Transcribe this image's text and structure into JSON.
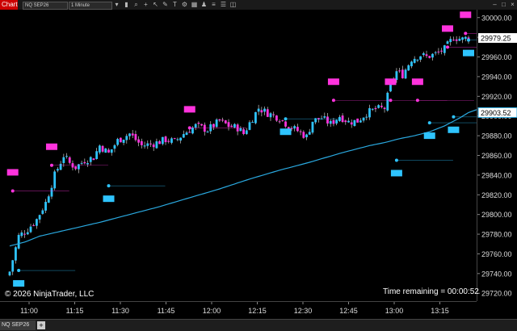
{
  "window": {
    "title": "Chart",
    "instrument": "NQ SEP26",
    "interval": "1 Minute",
    "bottom_tab": "NQ SEP26",
    "add_tab": "+"
  },
  "toolbar_icons": [
    "dropdown-icon",
    "bars-icon",
    "zoom-icon",
    "crosshair-icon",
    "pointer-icon",
    "draw-icon",
    "text-icon",
    "settings-icon",
    "grid-icon",
    "strategy-icon",
    "list-icon",
    "properties-icon",
    "chart-icon"
  ],
  "copyright": "© 2026 NinjaTrader, LLC",
  "time_remaining": "Time remaining = 00:00:52",
  "colors": {
    "up_candle": "#2ec4ff",
    "down_candle": "#ff33dd",
    "moving_average": "#2aa9e0",
    "high_marker": "#ff33dd",
    "low_marker": "#2ec4ff",
    "last_price_box": "#ffffff",
    "ma_price_box": "#ffffff"
  },
  "chart_data": {
    "type": "candlestick",
    "x_ticks": [
      "11:00",
      "11:15",
      "11:30",
      "11:45",
      "12:00",
      "12:15",
      "12:30",
      "12:45",
      "13:00",
      "13:15"
    ],
    "y_ticks": [
      "30000.00",
      "29980.00",
      "29960.00",
      "29940.00",
      "29920.00",
      "29900.00",
      "29880.00",
      "29860.00",
      "29840.00",
      "29820.00",
      "29800.00",
      "29780.00",
      "29760.00",
      "29740.00",
      "29720.00"
    ],
    "ylim": [
      29712,
      30008
    ],
    "last_price": "29979.25",
    "ma_price": "29903.52",
    "grid": false,
    "candle_count": 154,
    "close_path": [
      [
        0,
        29742
      ],
      [
        3,
        29778
      ],
      [
        6,
        29785
      ],
      [
        9,
        29795
      ],
      [
        12,
        29812
      ],
      [
        15,
        29840
      ],
      [
        18,
        29860
      ],
      [
        20,
        29852
      ],
      [
        22,
        29848
      ],
      [
        25,
        29855
      ],
      [
        28,
        29858
      ],
      [
        30,
        29870
      ],
      [
        33,
        29862
      ],
      [
        36,
        29875
      ],
      [
        40,
        29882
      ],
      [
        44,
        29870
      ],
      [
        48,
        29872
      ],
      [
        52,
        29876
      ],
      [
        55,
        29874
      ],
      [
        58,
        29882
      ],
      [
        62,
        29890
      ],
      [
        66,
        29886
      ],
      [
        70,
        29895
      ],
      [
        73,
        29890
      ],
      [
        76,
        29888
      ],
      [
        78,
        29882
      ],
      [
        80,
        29893
      ],
      [
        83,
        29908
      ],
      [
        86,
        29903
      ],
      [
        90,
        29898
      ],
      [
        93,
        29890
      ],
      [
        96,
        29885
      ],
      [
        99,
        29879
      ],
      [
        101,
        29895
      ],
      [
        104,
        29898
      ],
      [
        107,
        29892
      ],
      [
        110,
        29900
      ],
      [
        113,
        29894
      ],
      [
        116,
        29895
      ],
      [
        119,
        29903
      ],
      [
        122,
        29907
      ],
      [
        125,
        29908
      ],
      [
        127,
        29932
      ],
      [
        129,
        29945
      ],
      [
        131,
        29942
      ],
      [
        134,
        29958
      ],
      [
        137,
        29962
      ],
      [
        139,
        29960
      ],
      [
        142,
        29963
      ],
      [
        145,
        29968
      ],
      [
        148,
        29980
      ],
      [
        151,
        29978
      ],
      [
        153,
        29980
      ]
    ],
    "moving_average_path": [
      [
        0,
        29768
      ],
      [
        5,
        29772
      ],
      [
        10,
        29778
      ],
      [
        20,
        29785
      ],
      [
        30,
        29792
      ],
      [
        40,
        29800
      ],
      [
        50,
        29808
      ],
      [
        60,
        29817
      ],
      [
        70,
        29826
      ],
      [
        80,
        29836
      ],
      [
        90,
        29845
      ],
      [
        100,
        29853
      ],
      [
        110,
        29862
      ],
      [
        120,
        29870
      ],
      [
        125,
        29873
      ],
      [
        130,
        29877
      ],
      [
        135,
        29880
      ],
      [
        140,
        29884
      ],
      [
        145,
        29890
      ],
      [
        150,
        29898
      ],
      [
        153,
        29903.5
      ]
    ],
    "high_markers": [
      {
        "i": 1,
        "value": 29842
      },
      {
        "i": 14,
        "value": 29868
      },
      {
        "i": 60,
        "value": 29906
      },
      {
        "i": 108,
        "value": 29934
      },
      {
        "i": 127,
        "value": 29934
      },
      {
        "i": 136,
        "value": 29934
      },
      {
        "i": 146,
        "value": 29988
      },
      {
        "i": 152,
        "value": 30002
      }
    ],
    "low_markers": [
      {
        "i": 3,
        "value": 29730
      },
      {
        "i": 33,
        "value": 29816
      },
      {
        "i": 92,
        "value": 29884
      },
      {
        "i": 129,
        "value": 29842
      },
      {
        "i": 140,
        "value": 29880
      },
      {
        "i": 148,
        "value": 29886
      },
      {
        "i": 155,
        "value": 29964
      }
    ]
  }
}
